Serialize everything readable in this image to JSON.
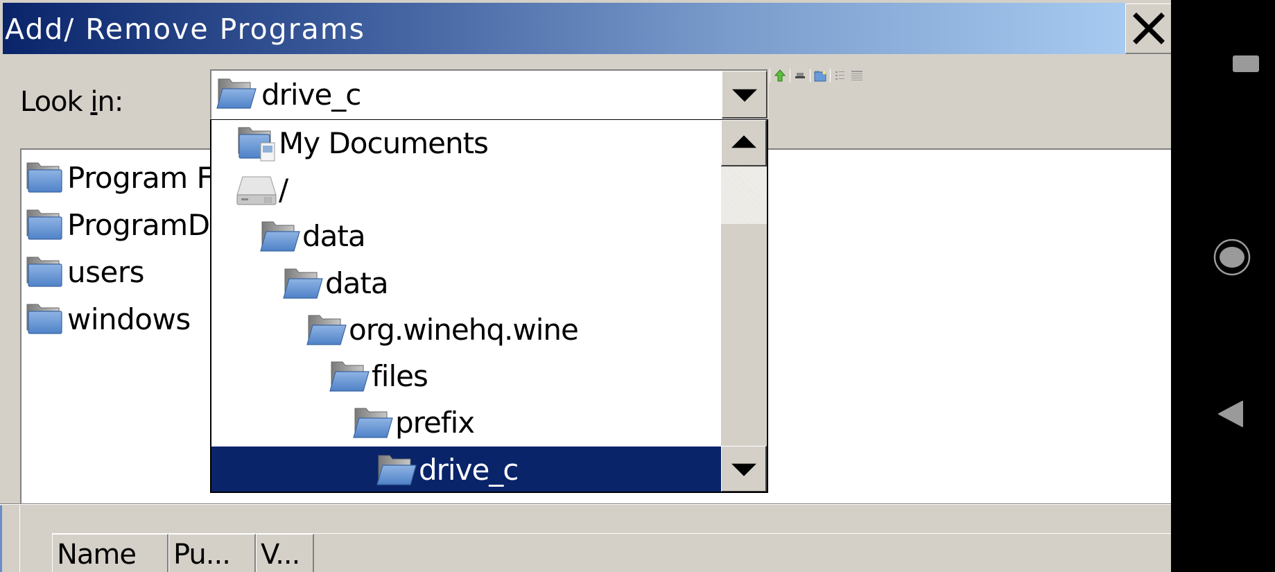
{
  "window": {
    "title": "Add/ Remove Programs",
    "close_icon": "close-icon",
    "title_gradient": [
      "#0a246a",
      "#a6caf0"
    ]
  },
  "look_in": {
    "label_pre": "Look ",
    "label_accel": "i",
    "label_post": "n:",
    "selected": "drive_c",
    "selected_icon": "folder-open-icon"
  },
  "toolbar": {
    "buttons": [
      {
        "name": "up-folder-button",
        "icon": "up-arrow-icon"
      },
      {
        "name": "desktop-button",
        "icon": "desktop-icon"
      },
      {
        "name": "new-folder-button",
        "icon": "new-folder-icon"
      },
      {
        "name": "list-view-button",
        "icon": "list-view-icon"
      },
      {
        "name": "details-view-button",
        "icon": "details-view-icon"
      }
    ]
  },
  "file_list": {
    "items": [
      {
        "name": "Program Files",
        "visible": "Program F",
        "icon": "folder-icon"
      },
      {
        "name": "ProgramData",
        "visible": "ProgramDa",
        "icon": "folder-icon"
      },
      {
        "name": "users",
        "visible": "users",
        "icon": "folder-icon"
      },
      {
        "name": "windows",
        "visible": "windows",
        "icon": "folder-icon"
      }
    ]
  },
  "dropdown": {
    "items": [
      {
        "label": "My Documents",
        "icon": "my-documents-icon",
        "depth": 0
      },
      {
        "label": "/",
        "icon": "hard-drive-icon",
        "depth": 0
      },
      {
        "label": "data",
        "icon": "folder-open-icon",
        "depth": 1
      },
      {
        "label": "data",
        "icon": "folder-open-icon",
        "depth": 2
      },
      {
        "label": "org.winehq.wine",
        "icon": "folder-open-icon",
        "depth": 3
      },
      {
        "label": "files",
        "icon": "folder-open-icon",
        "depth": 4
      },
      {
        "label": "prefix",
        "icon": "folder-open-icon",
        "depth": 5
      },
      {
        "label": "drive_c",
        "icon": "folder-open-icon",
        "depth": 6,
        "selected": true
      }
    ],
    "selection_color": "#0a246a"
  },
  "programs_table": {
    "columns": [
      "Name",
      "Pu...",
      "V..."
    ]
  },
  "android_nav": {
    "buttons": [
      "recents-button",
      "home-button",
      "back-button"
    ]
  }
}
